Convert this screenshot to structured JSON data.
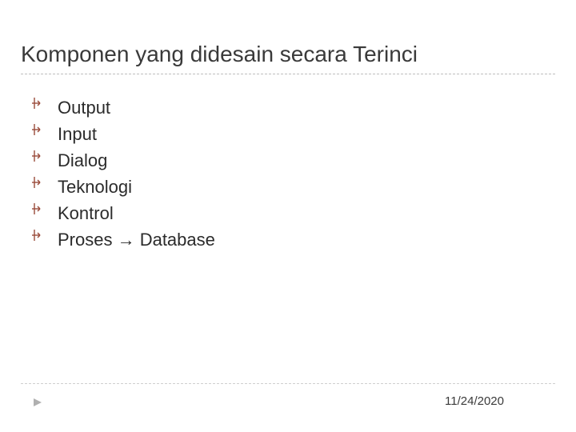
{
  "title": "Komponen yang didesain secara Terinci",
  "bullets": {
    "b0": "Output",
    "b1": "Input",
    "b2": "Dialog",
    "b3": "Teknologi",
    "b4": "Kontrol",
    "b5": "Proses → Database"
  },
  "footer": {
    "date": "11/24/2020"
  }
}
